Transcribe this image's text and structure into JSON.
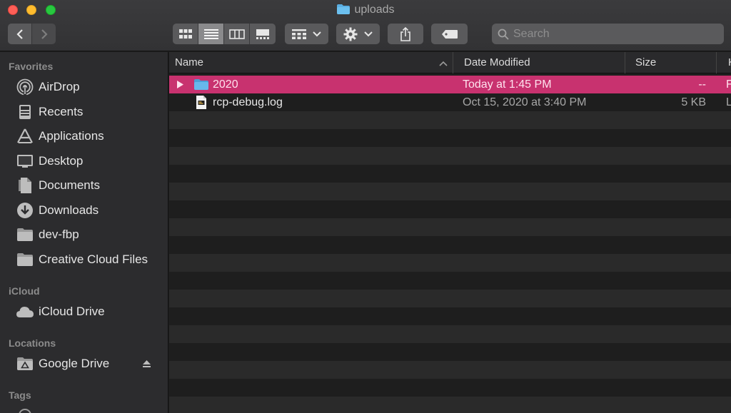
{
  "window": {
    "title": "uploads"
  },
  "toolbar": {
    "back_icon": "chevron-left-icon",
    "forward_icon": "chevron-right-icon",
    "views": [
      "icon-view",
      "list-view",
      "column-view",
      "gallery-view"
    ],
    "active_view": "list-view",
    "search_placeholder": "Search"
  },
  "sidebar": {
    "favorites_heading": "Favorites",
    "favorites": [
      {
        "label": "AirDrop",
        "icon": "airdrop-icon"
      },
      {
        "label": "Recents",
        "icon": "recents-icon"
      },
      {
        "label": "Applications",
        "icon": "applications-icon"
      },
      {
        "label": "Desktop",
        "icon": "desktop-icon"
      },
      {
        "label": "Documents",
        "icon": "documents-icon"
      },
      {
        "label": "Downloads",
        "icon": "downloads-icon"
      },
      {
        "label": "dev-fbp",
        "icon": "folder-icon"
      },
      {
        "label": "Creative Cloud Files",
        "icon": "folder-icon"
      }
    ],
    "icloud_heading": "iCloud",
    "icloud": [
      {
        "label": "iCloud Drive",
        "icon": "cloud-icon"
      }
    ],
    "locations_heading": "Locations",
    "locations": [
      {
        "label": "Google Drive",
        "icon": "drive-icon"
      }
    ],
    "tags_heading": "Tags"
  },
  "list": {
    "columns": {
      "name": "Name",
      "date": "Date Modified",
      "size": "Size",
      "kind": "K"
    },
    "rows": [
      {
        "name": "2020",
        "date": "Today at 1:45 PM",
        "size": "--",
        "kind": "F",
        "type": "folder",
        "selected": true
      },
      {
        "name": "rcp-debug.log",
        "date": "Oct 15, 2020 at 3:40 PM",
        "size": "5 KB",
        "kind": "L",
        "type": "log",
        "selected": false
      }
    ]
  },
  "colors": {
    "selection": "#c8326f",
    "folder": "#5aaee2"
  }
}
